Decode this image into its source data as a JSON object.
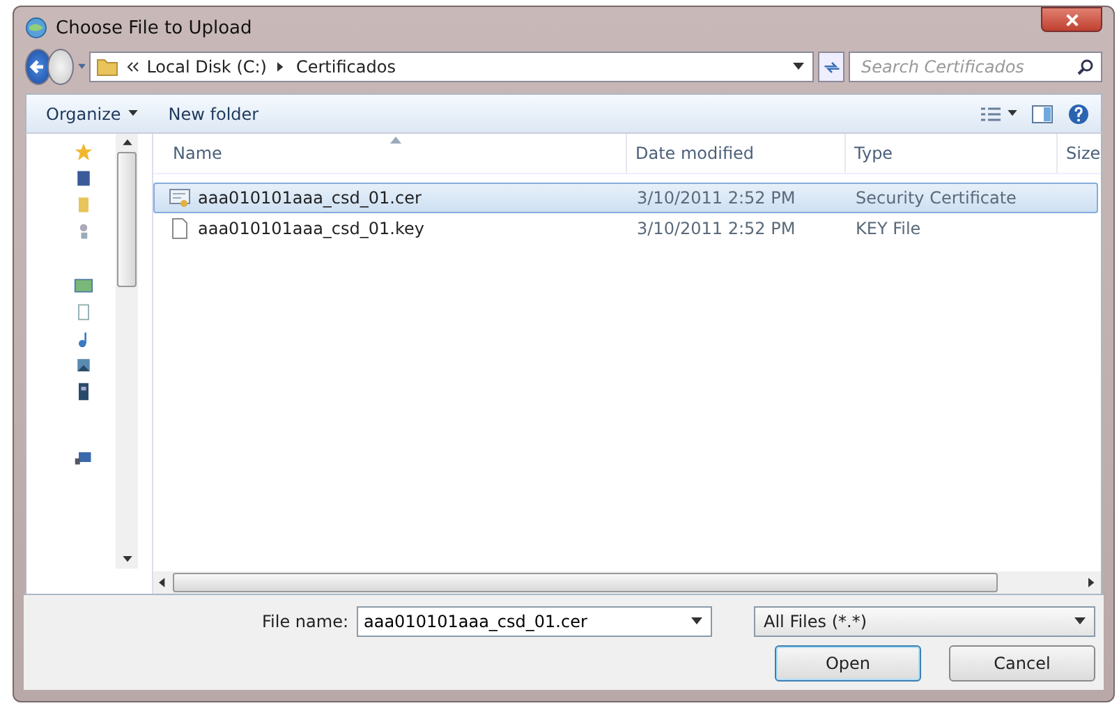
{
  "window": {
    "title": "Choose File to Upload"
  },
  "address": {
    "path": [
      {
        "label": "Local Disk (C:)"
      },
      {
        "label": "Certificados"
      }
    ],
    "search_placeholder": "Search Certificados"
  },
  "toolbar": {
    "organize": "Organize",
    "new_folder": "New folder"
  },
  "table": {
    "columns": [
      {
        "label": "Name",
        "sorted": true
      },
      {
        "label": "Date modified",
        "sorted": false
      },
      {
        "label": "Type",
        "sorted": false
      },
      {
        "label": "Size",
        "sorted": false
      }
    ],
    "rows": [
      {
        "kind": "certificate",
        "name": "aaa010101aaa_csd_01.cer",
        "date": "3/10/2011 2:52 PM",
        "type": "Security Certificate",
        "selected": true
      },
      {
        "kind": "document",
        "name": "aaa010101aaa_csd_01.key",
        "date": "3/10/2011 2:52 PM",
        "type": "KEY File",
        "selected": false
      }
    ]
  },
  "footer": {
    "file_name_label": "File name:",
    "file_name": "aaa010101aaa_csd_01.cer",
    "filter": "All Files (*.*)",
    "buttons": [
      {
        "label": "Open",
        "default": true
      },
      {
        "label": "Cancel",
        "default": false
      }
    ]
  }
}
